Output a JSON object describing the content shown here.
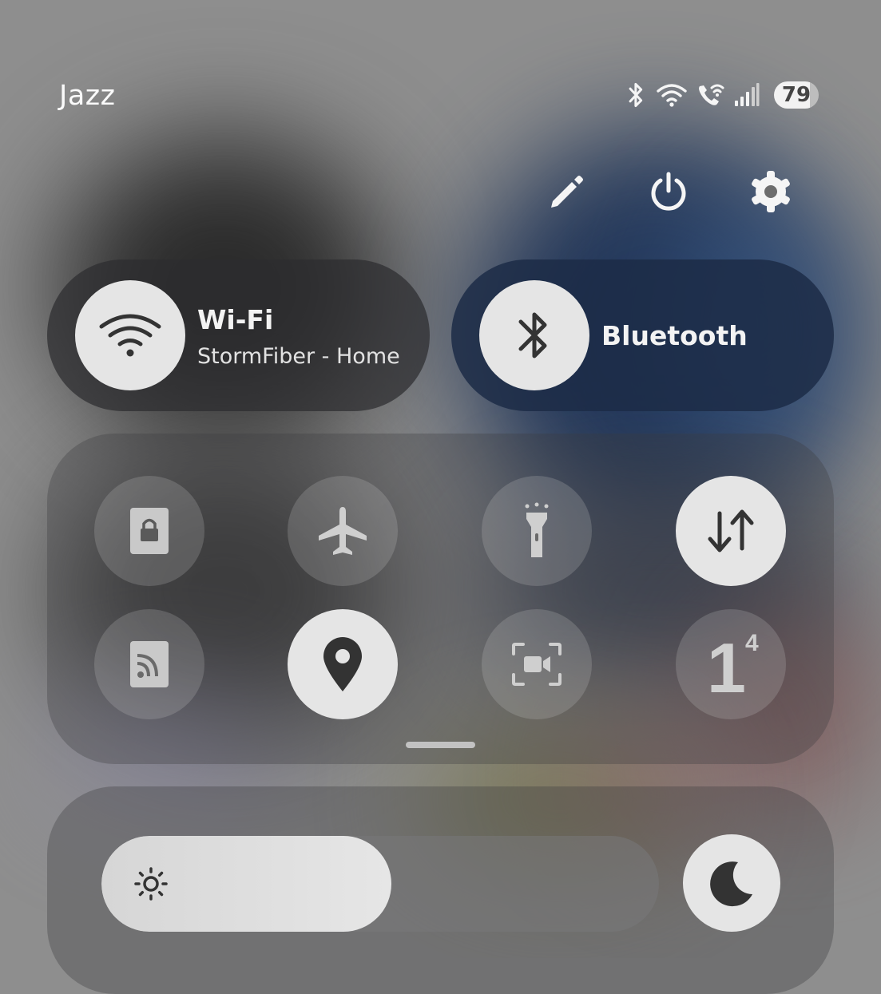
{
  "status_bar": {
    "carrier": "Jazz",
    "battery_level": "79",
    "icons": [
      "bluetooth-icon",
      "wifi-icon",
      "wifi-calling-icon",
      "signal-icon"
    ]
  },
  "top_actions": [
    "edit-icon",
    "power-icon",
    "settings-icon"
  ],
  "wifi": {
    "title": "Wi-Fi",
    "network": "StormFiber - Home",
    "on": true
  },
  "bluetooth": {
    "title": "Bluetooth",
    "on": true
  },
  "quick_tiles": [
    {
      "icon": "secure-folder-icon",
      "on": false
    },
    {
      "icon": "airplane-icon",
      "on": false
    },
    {
      "icon": "flashlight-icon",
      "on": false
    },
    {
      "icon": "mobile-data-icon",
      "on": true
    },
    {
      "icon": "cast-icon",
      "on": false
    },
    {
      "icon": "location-icon",
      "on": true
    },
    {
      "icon": "screen-recorder-icon",
      "on": false
    },
    {
      "icon": "app-tile-icon",
      "on": false,
      "glyph": "1",
      "sup": "4"
    }
  ],
  "brightness": {
    "level_fraction": 0.52,
    "icon": "sun-icon"
  },
  "dark_mode": {
    "icon": "moon-icon"
  },
  "colors": {
    "tile_on": "#e5e5e5",
    "text": "#f3f3f3",
    "bluetooth_pill": "#1c2b47"
  }
}
